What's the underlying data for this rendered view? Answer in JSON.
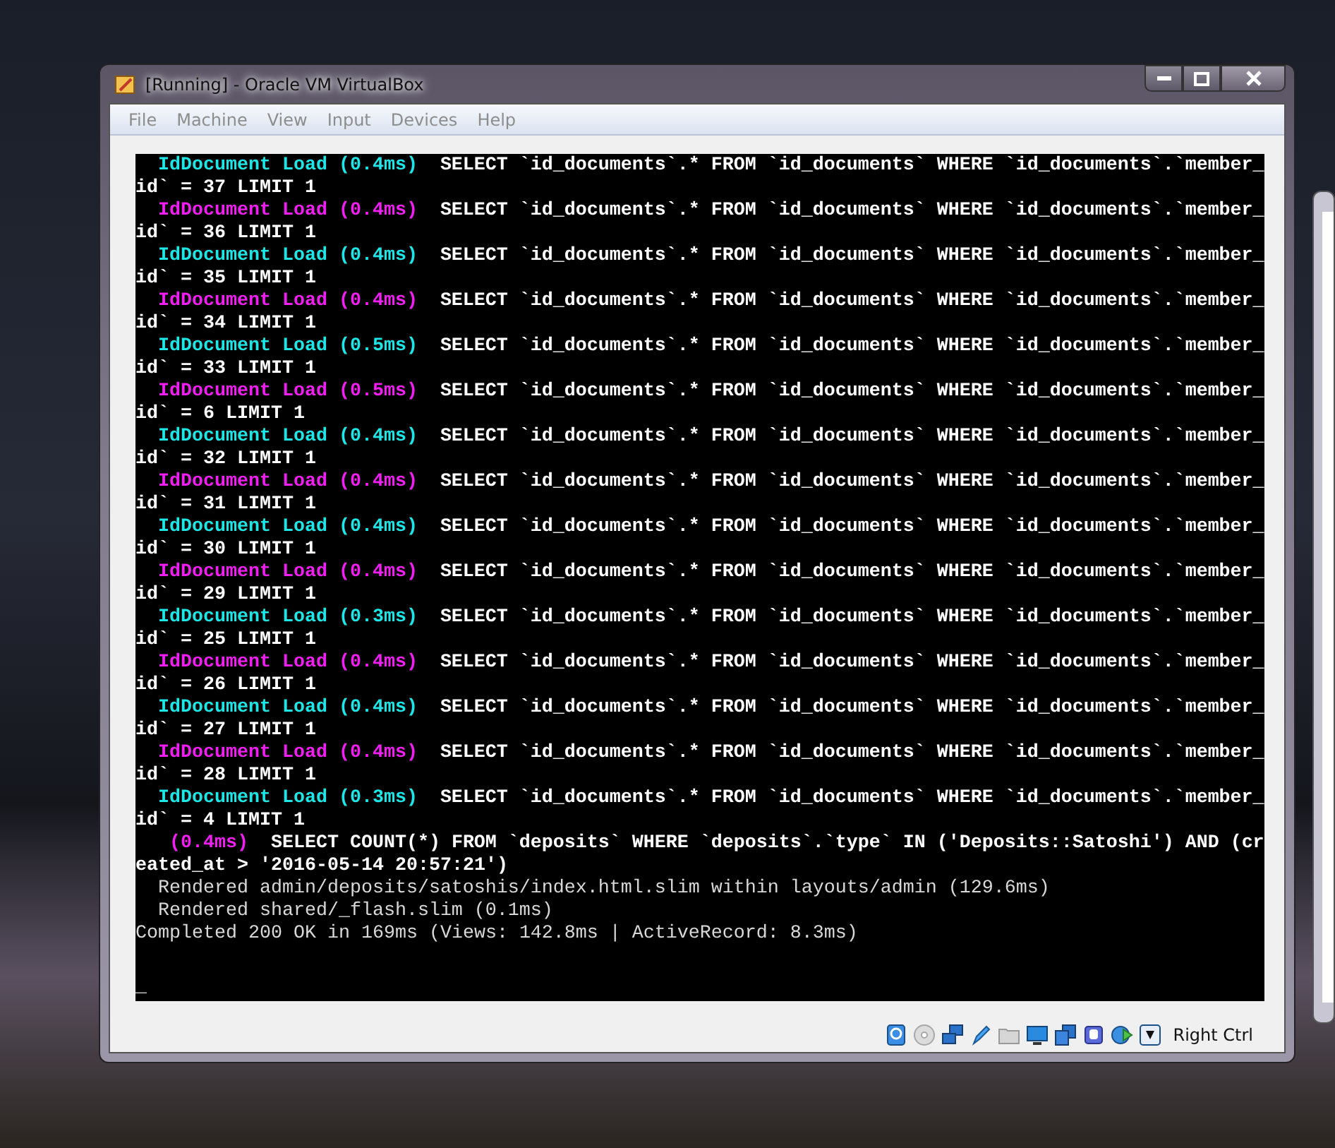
{
  "window": {
    "title": "[Running] - Oracle VM VirtualBox"
  },
  "menu": [
    "File",
    "Machine",
    "View",
    "Input",
    "Devices",
    "Help"
  ],
  "console": {
    "lines": [
      {
        "kind": "query",
        "color": "#1ee6e6",
        "label": "IdDocument Load (0.4ms)",
        "sql": "SELECT `id_documents`.* FROM `id_documents` WHERE `id_documents`.`member_",
        "continuation": "id` = 37 LIMIT 1"
      },
      {
        "kind": "query",
        "color": "#f01ef0",
        "label": "IdDocument Load (0.4ms)",
        "sql": "SELECT `id_documents`.* FROM `id_documents` WHERE `id_documents`.`member_",
        "continuation": "id` = 36 LIMIT 1"
      },
      {
        "kind": "query",
        "color": "#1ee6e6",
        "label": "IdDocument Load (0.4ms)",
        "sql": "SELECT `id_documents`.* FROM `id_documents` WHERE `id_documents`.`member_",
        "continuation": "id` = 35 LIMIT 1"
      },
      {
        "kind": "query",
        "color": "#f01ef0",
        "label": "IdDocument Load (0.4ms)",
        "sql": "SELECT `id_documents`.* FROM `id_documents` WHERE `id_documents`.`member_",
        "continuation": "id` = 34 LIMIT 1"
      },
      {
        "kind": "query",
        "color": "#1ee6e6",
        "label": "IdDocument Load (0.5ms)",
        "sql": "SELECT `id_documents`.* FROM `id_documents` WHERE `id_documents`.`member_",
        "continuation": "id` = 33 LIMIT 1"
      },
      {
        "kind": "query",
        "color": "#f01ef0",
        "label": "IdDocument Load (0.5ms)",
        "sql": "SELECT `id_documents`.* FROM `id_documents` WHERE `id_documents`.`member_",
        "continuation": "id` = 6 LIMIT 1"
      },
      {
        "kind": "query",
        "color": "#1ee6e6",
        "label": "IdDocument Load (0.4ms)",
        "sql": "SELECT `id_documents`.* FROM `id_documents` WHERE `id_documents`.`member_",
        "continuation": "id` = 32 LIMIT 1"
      },
      {
        "kind": "query",
        "color": "#f01ef0",
        "label": "IdDocument Load (0.4ms)",
        "sql": "SELECT `id_documents`.* FROM `id_documents` WHERE `id_documents`.`member_",
        "continuation": "id` = 31 LIMIT 1"
      },
      {
        "kind": "query",
        "color": "#1ee6e6",
        "label": "IdDocument Load (0.4ms)",
        "sql": "SELECT `id_documents`.* FROM `id_documents` WHERE `id_documents`.`member_",
        "continuation": "id` = 30 LIMIT 1"
      },
      {
        "kind": "query",
        "color": "#f01ef0",
        "label": "IdDocument Load (0.4ms)",
        "sql": "SELECT `id_documents`.* FROM `id_documents` WHERE `id_documents`.`member_",
        "continuation": "id` = 29 LIMIT 1"
      },
      {
        "kind": "query",
        "color": "#1ee6e6",
        "label": "IdDocument Load (0.3ms)",
        "sql": "SELECT `id_documents`.* FROM `id_documents` WHERE `id_documents`.`member_",
        "continuation": "id` = 25 LIMIT 1"
      },
      {
        "kind": "query",
        "color": "#f01ef0",
        "label": "IdDocument Load (0.4ms)",
        "sql": "SELECT `id_documents`.* FROM `id_documents` WHERE `id_documents`.`member_",
        "continuation": "id` = 26 LIMIT 1"
      },
      {
        "kind": "query",
        "color": "#1ee6e6",
        "label": "IdDocument Load (0.4ms)",
        "sql": "SELECT `id_documents`.* FROM `id_documents` WHERE `id_documents`.`member_",
        "continuation": "id` = 27 LIMIT 1"
      },
      {
        "kind": "query",
        "color": "#f01ef0",
        "label": "IdDocument Load (0.4ms)",
        "sql": "SELECT `id_documents`.* FROM `id_documents` WHERE `id_documents`.`member_",
        "continuation": "id` = 28 LIMIT 1"
      },
      {
        "kind": "query",
        "color": "#1ee6e6",
        "label": "IdDocument Load (0.3ms)",
        "sql": "SELECT `id_documents`.* FROM `id_documents` WHERE `id_documents`.`member_",
        "continuation": "id` = 4 LIMIT 1"
      },
      {
        "kind": "count",
        "color": "#f01ef0",
        "label": "(0.4ms)",
        "sql": "SELECT COUNT(*) FROM `deposits` WHERE `deposits`.`type` IN ('Deposits::Satoshi') AND (cr",
        "continuation": "eated_at > '2016-05-14 20:57:21')"
      },
      {
        "kind": "log",
        "text": "Rendered admin/deposits/satoshis/index.html.slim within layouts/admin (129.6ms)"
      },
      {
        "kind": "log",
        "text": "Rendered shared/_flash.slim (0.1ms)"
      },
      {
        "kind": "plain",
        "text": "Completed 200 OK in 169ms (Views: 142.8ms | ActiveRecord: 8.3ms)"
      },
      {
        "kind": "cursor",
        "text": "_"
      }
    ]
  },
  "status_bar": {
    "host_key": "Right Ctrl"
  }
}
